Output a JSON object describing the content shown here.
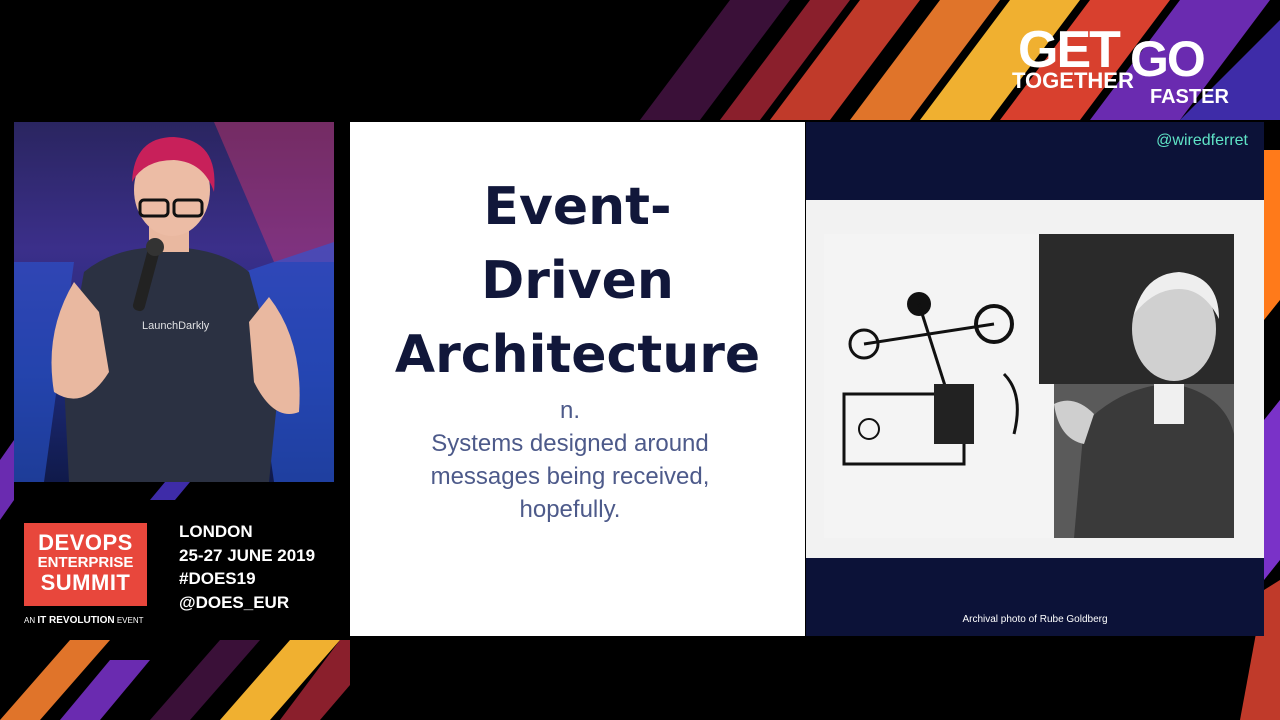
{
  "slide": {
    "title_lines": [
      "Event-",
      "Driven",
      "Architecture"
    ],
    "definition_lines": [
      "n.",
      "Systems designed around",
      "messages being received,",
      "hopefully."
    ],
    "handle": "@wiredferret",
    "photo_caption": "Archival photo of Rube Goldberg"
  },
  "speaker": {
    "shirt_text": "LaunchDarkly"
  },
  "branding": {
    "logo_lines": [
      "DEVOPS",
      "ENTERPRISE",
      "SUMMIT"
    ],
    "event_prefix": "AN",
    "event_org": "IT REVOLUTION",
    "event_suffix": "EVENT",
    "info_lines": [
      "LONDON",
      "25-27 JUNE 2019",
      "#DOES19",
      "@DOES_EUR"
    ],
    "tagline": {
      "get": "GET",
      "together": "TOGETHER",
      "go": "GO",
      "faster": "FASTER"
    }
  },
  "colors": {
    "slide_title": "#11173a",
    "slide_text": "#4d5a8a",
    "handle": "#5fe3c6",
    "logo_bg": "#e8473c",
    "slide_dark": "#0c1238"
  }
}
